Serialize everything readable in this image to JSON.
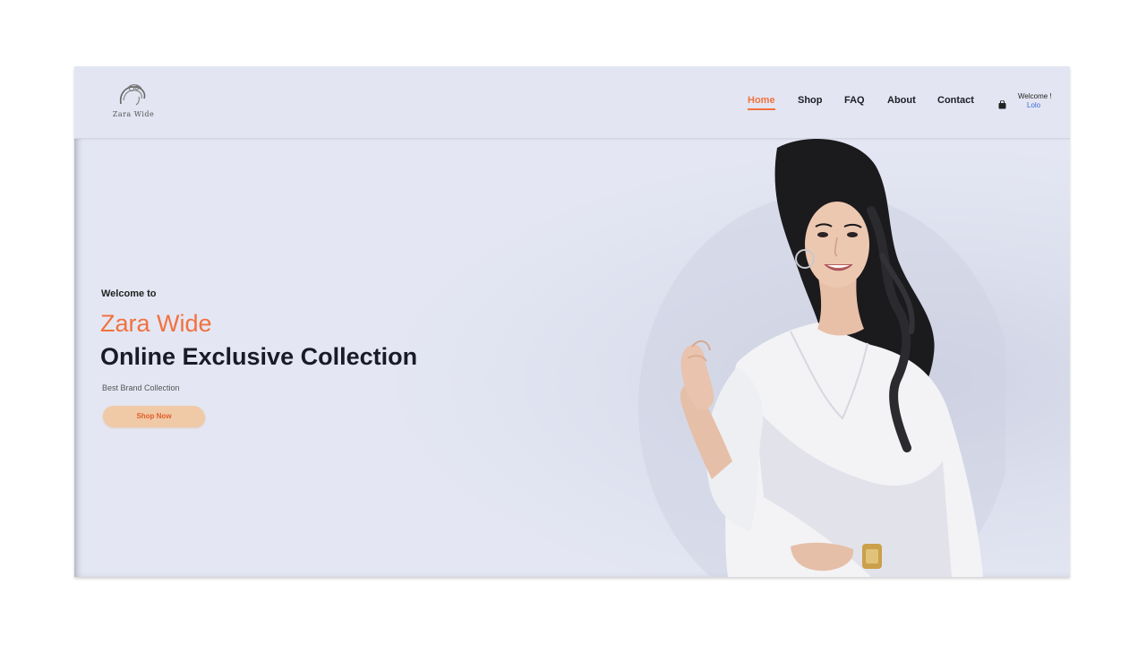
{
  "brand": {
    "logo_text": "Zara Wide"
  },
  "nav": {
    "items": [
      {
        "label": "Home",
        "active": true
      },
      {
        "label": "Shop",
        "active": false
      },
      {
        "label": "FAQ",
        "active": false
      },
      {
        "label": "About",
        "active": false
      },
      {
        "label": "Contact",
        "active": false
      }
    ],
    "cart_icon": "shopping-bag-icon",
    "user_greeting": "Welcome !",
    "user_name": "Lolo"
  },
  "hero": {
    "welcome": "Welcome to",
    "title": "Zara Wide",
    "subtitle": "Online Exclusive Collection",
    "description": "Best Brand Collection",
    "button": "Shop Now"
  },
  "colors": {
    "accent": "#f2713f",
    "background": "#e4e7f3",
    "button_bg": "#f0c9a6",
    "link_blue": "#3f6ad8"
  }
}
